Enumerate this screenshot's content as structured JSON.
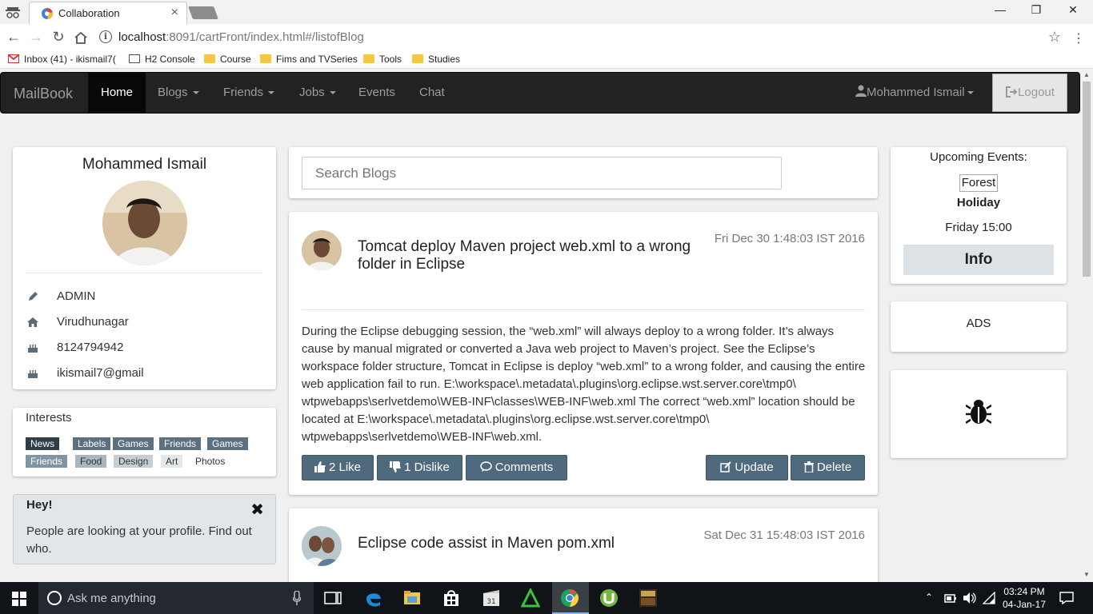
{
  "browser": {
    "tab_title": "Collaboration",
    "tab_close": "×",
    "url_host": "localhost",
    "url_path": ":8091/cartFront/index.html#/listofBlog",
    "bookmarks": [
      "Inbox (41) - ikismail7(",
      "H2 Console",
      "Course",
      "Fims and TVSeries",
      "Tools",
      "Studies"
    ]
  },
  "navbar": {
    "brand": "MailBook",
    "items": [
      "Home",
      "Blogs",
      "Friends",
      "Jobs",
      "Events",
      "Chat"
    ],
    "user": "Mohammed Ismail",
    "logout": "Logout"
  },
  "profile": {
    "name": "Mohammed Ismail",
    "role": "ADMIN",
    "city": "Virudhunagar",
    "phone": "8124794942",
    "email": "ikismail7@gmail"
  },
  "interests": {
    "title": "Interests",
    "tags": [
      {
        "label": "News",
        "color": "#2f3e48"
      },
      {
        "label": "Labels",
        "color": "#5c7080"
      },
      {
        "label": "Games",
        "color": "#5c7080"
      },
      {
        "label": "Friends",
        "color": "#5c7080"
      },
      {
        "label": "Games",
        "color": "#5c7080"
      },
      {
        "label": "Friends",
        "color": "#7f95a3"
      },
      {
        "label": "Food",
        "color": "#a9b6be"
      },
      {
        "label": "Design",
        "color": "#c5ced3"
      },
      {
        "label": "Art",
        "color": "#e3e7ea"
      },
      {
        "label": "Photos",
        "color": "#ffffff"
      }
    ]
  },
  "alert": {
    "title": "Hey!",
    "text": "People are looking at your profile. Find out who.",
    "close": "✖"
  },
  "search": {
    "placeholder": "Search Blogs"
  },
  "blogs": [
    {
      "title": "Tomcat deploy Maven project web.xml to a wrong folder in Eclipse",
      "date": "Fri Dec 30 1:48:03 IST 2016",
      "body": "During the Eclipse debugging session, the “web.xml” will always deploy to a wrong folder. It’s always cause by manual migrated or converted a Java web project to Maven’s project. See the Eclipse’s workspace folder structure, Tomcat in Eclipse is deploy “web.xml” to a wrong folder, and causing the entire web application fail to run. E:\\workspace\\.metadata\\.plugins\\org.eclipse.wst.server.core\\tmp0\\ wtpwebapps\\serlvetdemo\\WEB-INF\\classes\\WEB-INF\\web.xml The correct “web.xml” location should be located at E:\\workspace\\.metadata\\.plugins\\org.eclipse.wst.server.core\\tmp0\\ wtpwebapps\\serlvetdemo\\WEB-INF\\web.xml.",
      "like": "2 Like",
      "dislike": "1 Dislike",
      "comments": "Comments",
      "update": "Update",
      "delete": "Delete"
    },
    {
      "title": "Eclipse code assist in Maven pom.xml",
      "date": "Sat Dec 31 15:48:03 IST 2016"
    }
  ],
  "events": {
    "title": "Upcoming Events:",
    "event_line1": "Forest",
    "event_line2": "Holiday",
    "time": "Friday 15:00",
    "info": "Info"
  },
  "ads": {
    "label": "ADS"
  },
  "taskbar": {
    "search_placeholder": "Ask me anything",
    "time": "03:24 PM",
    "date": "04-Jan-17"
  }
}
